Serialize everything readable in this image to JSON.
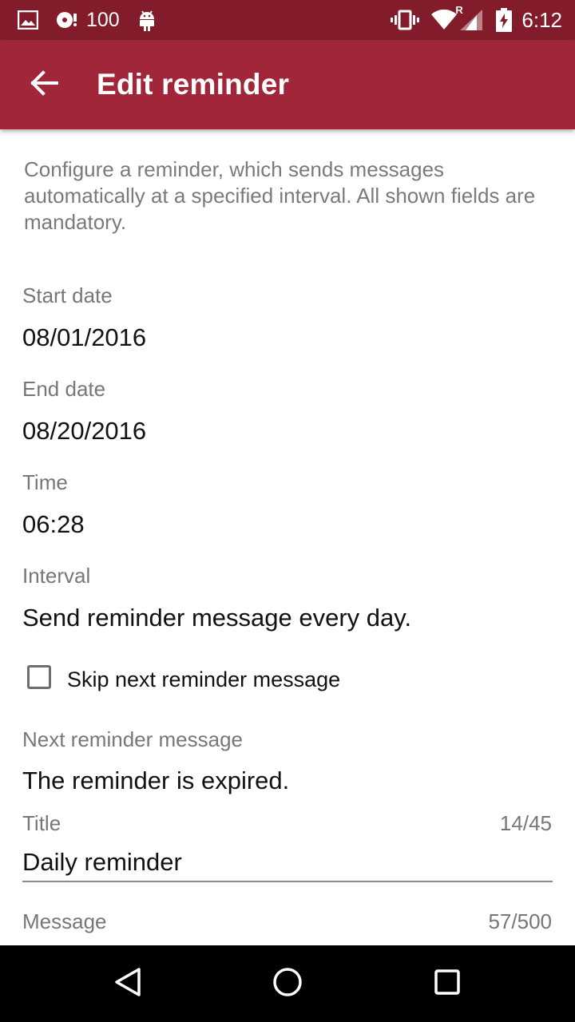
{
  "status_bar": {
    "battery_text": "100",
    "time": "6:12",
    "network_roaming": "R",
    "icons": [
      "image-icon",
      "media-icon",
      "android-icon",
      "vibrate-icon",
      "wifi-icon",
      "signal-icon",
      "battery-charging-icon"
    ]
  },
  "app_bar": {
    "title": "Edit reminder",
    "back_icon": "arrow-back-icon"
  },
  "form": {
    "intro": "Configure a reminder, which sends messages automatically at a specified interval. All shown fields are mandatory.",
    "start_date_label": "Start date",
    "start_date_value": "08/01/2016",
    "end_date_label": "End date",
    "end_date_value": "08/20/2016",
    "time_label": "Time",
    "time_value": "06:28",
    "interval_label": "Interval",
    "interval_value": "Send reminder message every day.",
    "skip_label": "Skip next reminder message",
    "skip_checked": false,
    "next_label": "Next reminder message",
    "next_value": "The reminder is expired.",
    "title_label": "Title",
    "title_counter": "14/45",
    "title_value": "Daily reminder",
    "message_label": "Message",
    "message_counter": "57/500"
  },
  "nav_bar": {
    "icons": [
      "back-triangle-icon",
      "home-circle-icon",
      "recents-square-icon"
    ]
  },
  "colors": {
    "status_bar": "#821c2a",
    "app_bar": "#a1263a",
    "label_gray": "#777777"
  }
}
